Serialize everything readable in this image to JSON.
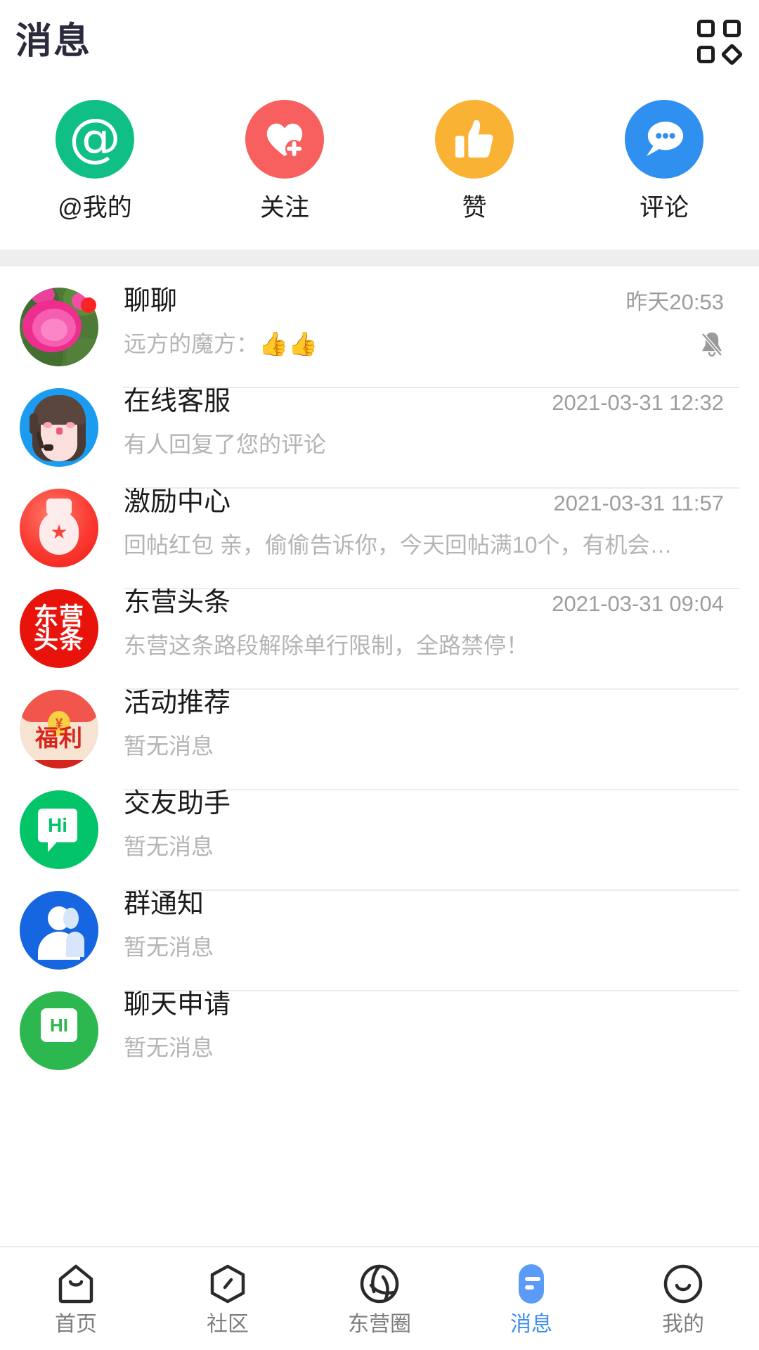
{
  "header": {
    "title": "消息",
    "grid_icon": "grid-apps-icon"
  },
  "quick_actions": [
    {
      "label": "@我的",
      "icon": "at-icon",
      "color": "#0fbf86"
    },
    {
      "label": "关注",
      "icon": "heart-plus-icon",
      "color": "#f86060"
    },
    {
      "label": "赞",
      "icon": "thumbs-up-icon",
      "color": "#f9b233"
    },
    {
      "label": "评论",
      "icon": "comment-bubble-icon",
      "color": "#2f90f0"
    }
  ],
  "messages": [
    {
      "title": "聊聊",
      "preview": "远方的魔方：",
      "preview_emoji": "👍👍",
      "time": "昨天20:53",
      "avatar": "flower-avatar",
      "unread_dot": true,
      "muted": true
    },
    {
      "title": "在线客服",
      "preview": "有人回复了您的评论",
      "preview_emoji": "",
      "time": "2021-03-31 12:32",
      "avatar": "customer-service-avatar",
      "unread_dot": false,
      "muted": false
    },
    {
      "title": "激励中心",
      "preview": "回帖红包 亲，偷偷告诉你，今天回帖满10个，有机会…",
      "preview_emoji": "",
      "time": "2021-03-31 11:57",
      "avatar": "reward-medal-avatar",
      "unread_dot": false,
      "muted": false
    },
    {
      "title": "东营头条",
      "preview": "东营这条路段解除单行限制，全路禁停！",
      "preview_emoji": "",
      "time": "2021-03-31 09:04",
      "avatar": "dongying-news-avatar",
      "avatar_text_top": "东营",
      "avatar_text_bottom": "头条",
      "unread_dot": false,
      "muted": false
    },
    {
      "title": "活动推荐",
      "preview": "暂无消息",
      "preview_emoji": "",
      "time": "",
      "avatar": "welfare-redpacket-avatar",
      "avatar_text": "福利",
      "unread_dot": false,
      "muted": false
    },
    {
      "title": "交友助手",
      "preview": "暂无消息",
      "preview_emoji": "",
      "time": "",
      "avatar": "friend-helper-avatar",
      "avatar_text": "Hi",
      "unread_dot": false,
      "muted": false
    },
    {
      "title": "群通知",
      "preview": "暂无消息",
      "preview_emoji": "",
      "time": "",
      "avatar": "group-notice-avatar",
      "unread_dot": false,
      "muted": false
    },
    {
      "title": "聊天申请",
      "preview": "暂无消息",
      "preview_emoji": "",
      "time": "",
      "avatar": "chat-request-avatar",
      "avatar_text": "HI",
      "unread_dot": false,
      "muted": false
    }
  ],
  "tabbar": {
    "active_color": "#3d8df5",
    "items": [
      {
        "label": "首页",
        "icon": "home-icon",
        "active": false
      },
      {
        "label": "社区",
        "icon": "community-icon",
        "active": false
      },
      {
        "label": "东营圈",
        "icon": "aperture-icon",
        "active": false
      },
      {
        "label": "消息",
        "icon": "message-icon",
        "active": true
      },
      {
        "label": "我的",
        "icon": "profile-icon",
        "active": false
      }
    ]
  }
}
